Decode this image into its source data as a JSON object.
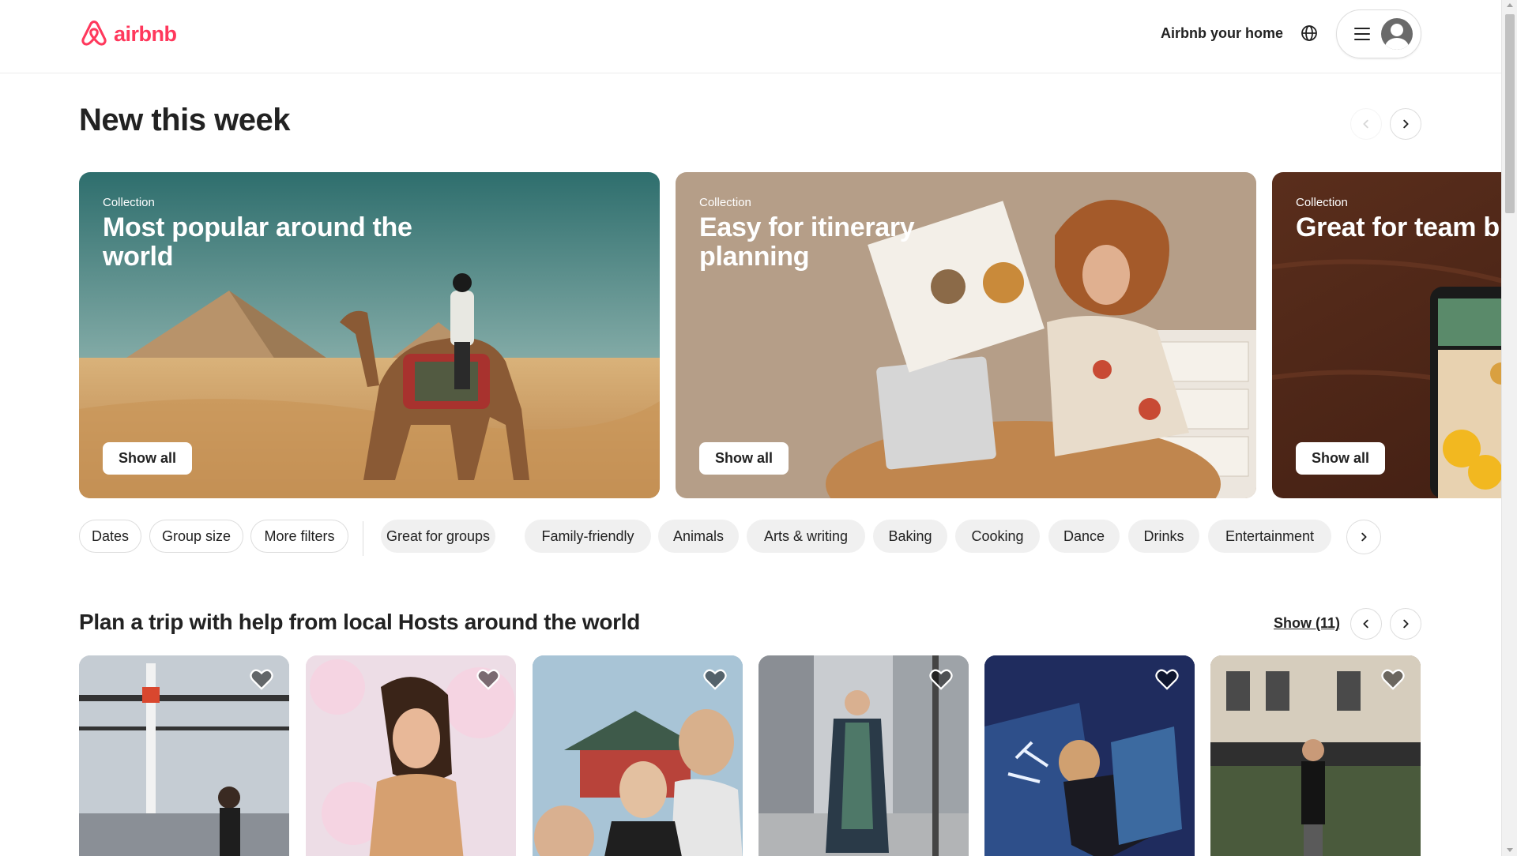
{
  "header": {
    "logo_text": "airbnb",
    "host_link": "Airbnb your home",
    "globe_icon": "globe-icon",
    "menu_icon": "hamburger-icon",
    "avatar_icon": "user-avatar-icon"
  },
  "section_new": {
    "title": "New this week",
    "cards": [
      {
        "eyebrow": "Collection",
        "title": "Most popular around the world",
        "button": "Show all"
      },
      {
        "eyebrow": "Collection",
        "title": "Easy for itinerary planning",
        "button": "Show all"
      },
      {
        "eyebrow": "Collection",
        "title": "Great for team building",
        "button": "Show all"
      }
    ]
  },
  "filters": {
    "primary": [
      "Dates",
      "Group size",
      "More filters"
    ],
    "categories": [
      "Great for groups",
      "Family-friendly",
      "Animals",
      "Arts & writing",
      "Baking",
      "Cooking",
      "Dance",
      "Drinks",
      "Entertainment"
    ]
  },
  "section_plan": {
    "title": "Plan a trip with help from local Hosts around the world",
    "show_link": "Show (11)",
    "card_count": 6
  },
  "colors": {
    "brand": "#FF385C",
    "text": "#222222",
    "chip_fill": "#f0f0f0",
    "border": "#dddddd"
  }
}
